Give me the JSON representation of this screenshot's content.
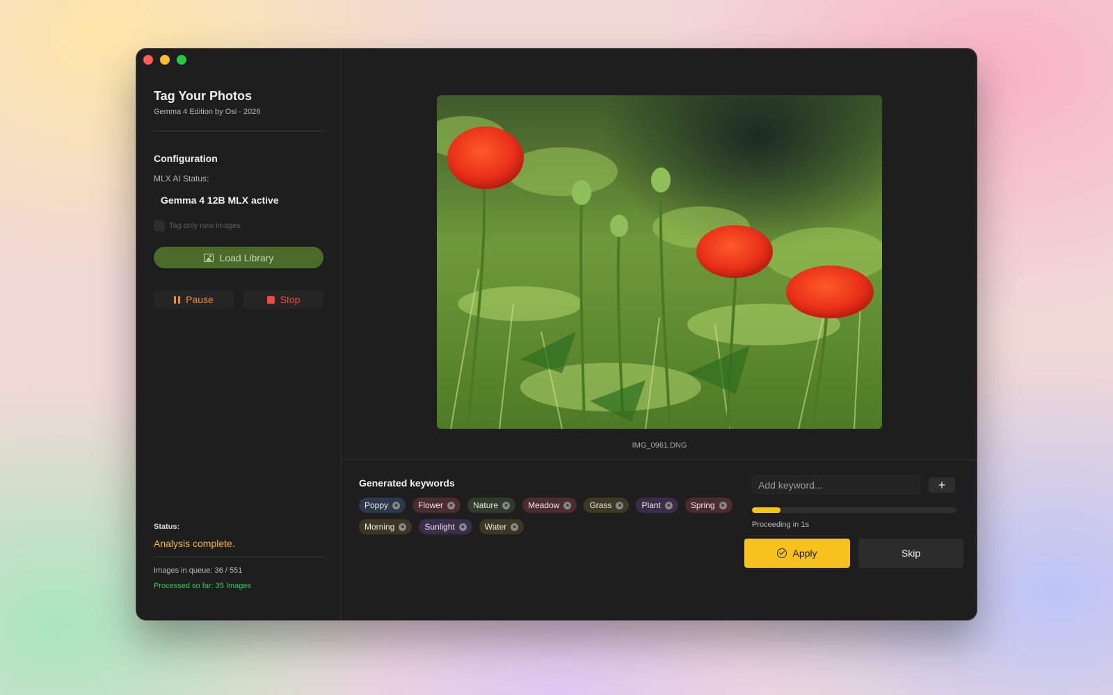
{
  "window": {
    "title": ""
  },
  "sidebar": {
    "app_title": "Tag Your Photos",
    "app_subtitle": "Gemma 4 Edition by Osi · 2026",
    "section_title": "Configuration",
    "mlx_label": "MLX AI Status:",
    "mlx_value": "Gemma 4 12B MLX active",
    "checkbox_label": "Tag only new images",
    "checkbox_checked": false,
    "load_button": "Load Library",
    "pause_button": "Pause",
    "stop_button": "Stop",
    "status_label": "Status:",
    "status_value": "Analysis complete.",
    "queue_text": "Images in queue: 36 / 551",
    "processed_text": "Processed so far: 35 Images"
  },
  "main": {
    "filename": "IMG_0961.DNG",
    "keywords_title": "Generated keywords",
    "keywords": [
      {
        "label": "Poppy",
        "color": "#2d3a4d"
      },
      {
        "label": "Flower",
        "color": "#4d2b32"
      },
      {
        "label": "Nature",
        "color": "#2e3d2a"
      },
      {
        "label": "Meadow",
        "color": "#4d2b32"
      },
      {
        "label": "Grass",
        "color": "#3d3a24"
      },
      {
        "label": "Plant",
        "color": "#3a2d4a"
      },
      {
        "label": "Spring",
        "color": "#4d2b32"
      },
      {
        "label": "Morning",
        "color": "#3d3622"
      },
      {
        "label": "Sunlight",
        "color": "#3a2d4a"
      },
      {
        "label": "Water",
        "color": "#3d3622"
      }
    ],
    "add_keyword_placeholder": "Add keyword...",
    "add_button": "+",
    "progress": 0.14,
    "proceeding_text": "Proceeding in 1s",
    "apply_button": "Apply",
    "skip_button": "Skip"
  },
  "colors": {
    "accent": "#f8c21c",
    "status": "#f5b82e",
    "processed": "#35c759",
    "load_button": "#4a6b2a"
  }
}
